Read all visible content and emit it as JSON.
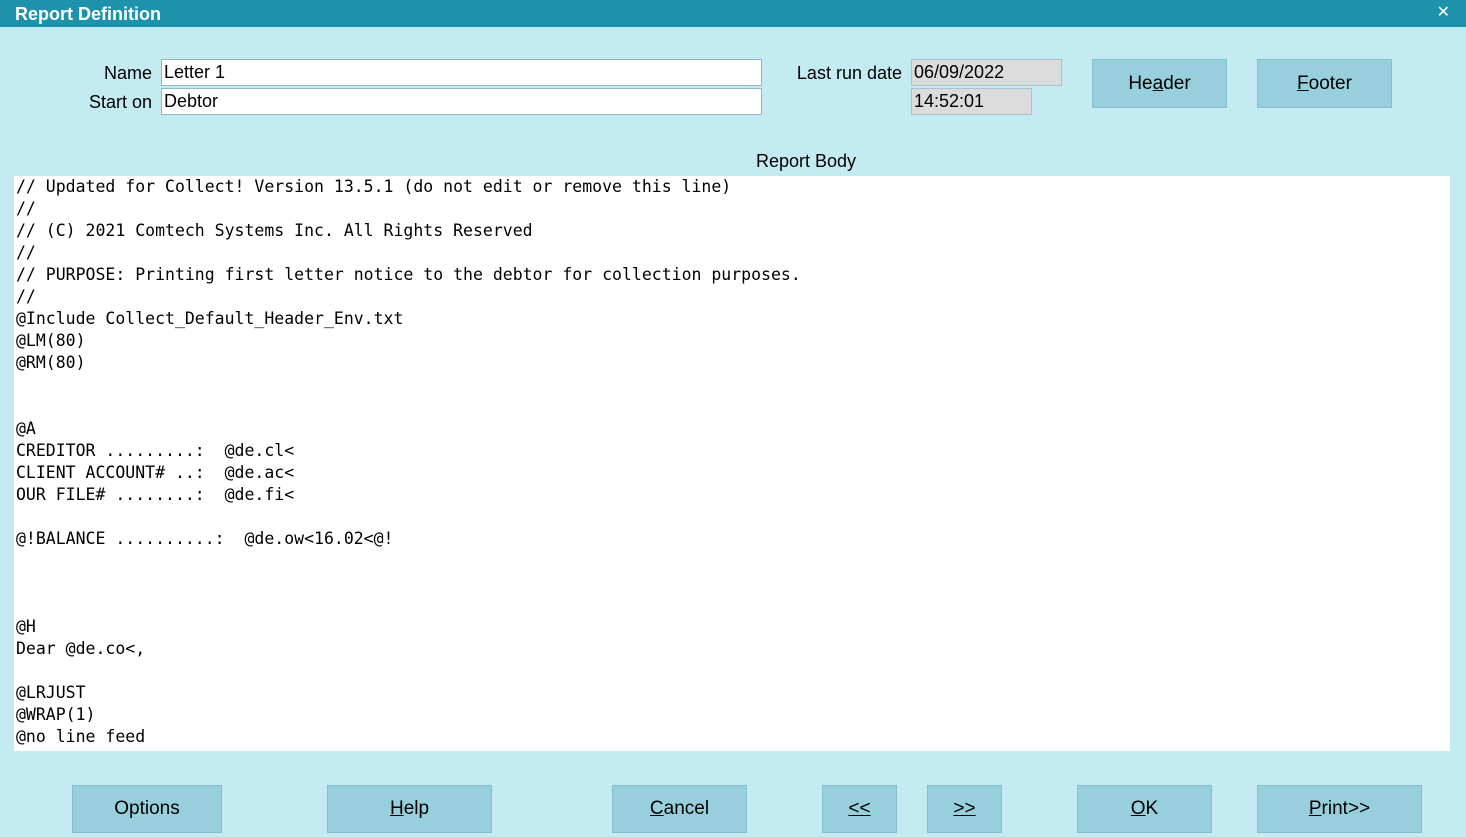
{
  "window": {
    "title": "Report Definition",
    "close_glyph": "✕"
  },
  "form": {
    "name_label": "Name",
    "name_value": "Letter 1",
    "start_on_label": "Start on",
    "start_on_value": "Debtor",
    "last_run_label": "Last run date",
    "last_run_date": "06/09/2022",
    "last_run_time": "14:52:01"
  },
  "top_buttons": {
    "header": {
      "pre": "He",
      "key": "a",
      "post": "der"
    },
    "footer": {
      "pre": "",
      "key": "F",
      "post": "ooter"
    }
  },
  "report_body": {
    "label": "Report Body",
    "text": "// Updated for Collect! Version 13.5.1 (do not edit or remove this line)\n//\n// (C) 2021 Comtech Systems Inc. All Rights Reserved\n//\n// PURPOSE: Printing first letter notice to the debtor for collection purposes.\n//\n@Include Collect_Default_Header_Env.txt\n@LM(80)\n@RM(80)\n\n\n@A\nCREDITOR .........:  @de.cl<\nCLIENT ACCOUNT# ..:  @de.ac<\nOUR FILE# ........:  @de.fi<\n\n@!BALANCE ..........:  @de.ow<16.02<@!\n\n\n\n@H\nDear @de.co<,\n\n@LRJUST\n@WRAP(1)\n@no line feed"
  },
  "bottom_buttons": {
    "options": {
      "pre": "",
      "key": "",
      "post": "Options"
    },
    "help": {
      "pre": "",
      "key": "H",
      "post": "elp"
    },
    "cancel": {
      "pre": "",
      "key": "C",
      "post": "ancel"
    },
    "prev": {
      "pre": "",
      "key": "<<",
      "post": ""
    },
    "next": {
      "pre": "",
      "key": ">>",
      "post": ""
    },
    "ok": {
      "pre": "",
      "key": "O",
      "post": "K"
    },
    "print": {
      "pre": "",
      "key": "P",
      "post": "rint>>"
    }
  },
  "colors": {
    "window_bg": "#c4eaf2",
    "titlebar_bg": "#1e92aa",
    "button_bg": "#97d0dc",
    "readonly_bg": "#dcdcdc"
  }
}
